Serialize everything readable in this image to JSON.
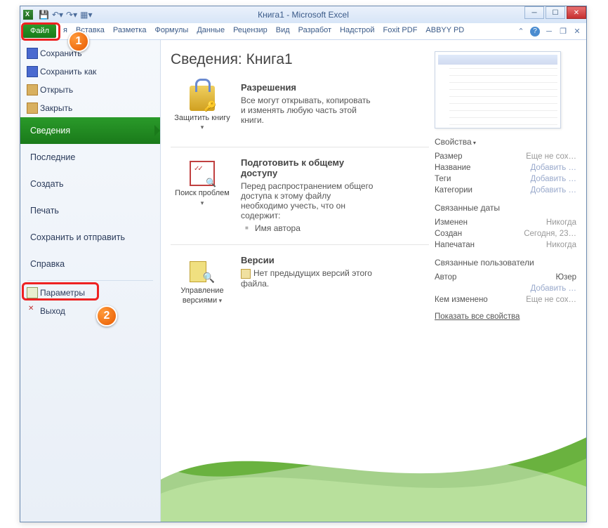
{
  "title": "Книга1  -  Microsoft Excel",
  "ribbon": {
    "file": "Файл",
    "tabs": [
      "я",
      "Вставка",
      "Разметка",
      "Формулы",
      "Данные",
      "Рецензир",
      "Вид",
      "Разработ",
      "Надстрой",
      "Foxit PDF",
      "ABBYY PD"
    ]
  },
  "sidebar": {
    "save": "Сохранить",
    "save_as": "Сохранить как",
    "open": "Открыть",
    "close": "Закрыть",
    "info": "Сведения",
    "recent": "Последние",
    "new": "Создать",
    "print": "Печать",
    "share": "Сохранить и отправить",
    "help": "Справка",
    "options": "Параметры",
    "exit": "Выход"
  },
  "content": {
    "heading": "Сведения: Книга1",
    "protect_btn": "Защитить книгу",
    "protect_title": "Разрешения",
    "protect_text": "Все могут открывать, копировать и изменять любую часть этой книги.",
    "inspect_btn": "Поиск проблем",
    "inspect_title": "Подготовить к общему доступу",
    "inspect_text": "Перед распространением общего доступа к этому файлу необходимо учесть, что он содержит:",
    "inspect_bullet": "Имя автора",
    "versions_btn": "Управление версиями",
    "versions_title": "Версии",
    "versions_text": "Нет предыдущих версий этого файла."
  },
  "props": {
    "heading": "Свойства",
    "size_l": "Размер",
    "size_v": "Еще не сох…",
    "title_l": "Название",
    "title_v": "Добавить …",
    "tags_l": "Теги",
    "tags_v": "Добавить …",
    "cat_l": "Категории",
    "cat_v": "Добавить …",
    "dates_heading": "Связанные даты",
    "mod_l": "Изменен",
    "mod_v": "Никогда",
    "created_l": "Создан",
    "created_v": "Сегодня, 23…",
    "printed_l": "Напечатан",
    "printed_v": "Никогда",
    "people_heading": "Связанные пользователи",
    "author_l": "Автор",
    "author_v": "Юзер",
    "author_add": "Добавить …",
    "changed_l": "Кем изменено",
    "changed_v": "Еще не сох…",
    "show_all": "Показать все свойства"
  },
  "badges": {
    "one": "1",
    "two": "2"
  }
}
